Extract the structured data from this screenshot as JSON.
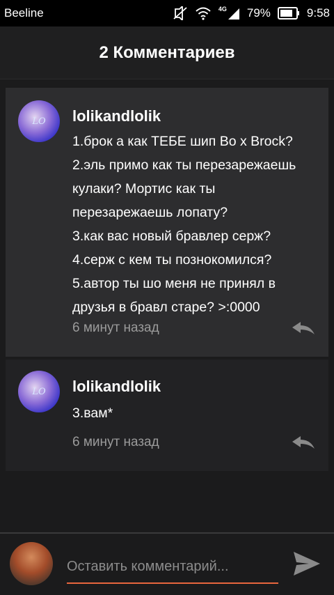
{
  "status_bar": {
    "carrier": "Beeline",
    "network": "4G",
    "battery": "79%",
    "time": "9:58"
  },
  "header": {
    "title": "2 Комментариев"
  },
  "comments": [
    {
      "username": "lolikandlolik",
      "avatar_text": "LO",
      "lines": [
        "1.брок а как ТЕБЕ шип Bo x Brock?",
        "2.эль примо как ты перезарежаешь",
        "кулаки? Мортис как ты",
        "перезарежаешь лопату?",
        "3.как вас новый бравлер серж?",
        "4.серж с кем ты познокомился?",
        "5.автор ты шо меня не принял в",
        "друзья в бравл старе? >:0000"
      ],
      "time": "6 минут назад"
    },
    {
      "username": "lolikandlolik",
      "avatar_text": "LO",
      "lines": [
        "3.вам*"
      ],
      "time": "6 минут назад"
    }
  ],
  "composer": {
    "placeholder": "Оставить комментарий...",
    "accent_color": "#e8663d"
  },
  "icons": {
    "mute": "mute-icon",
    "wifi": "wifi-icon",
    "signal": "signal-icon",
    "battery": "battery-icon",
    "reply": "reply-icon",
    "send": "send-icon"
  }
}
